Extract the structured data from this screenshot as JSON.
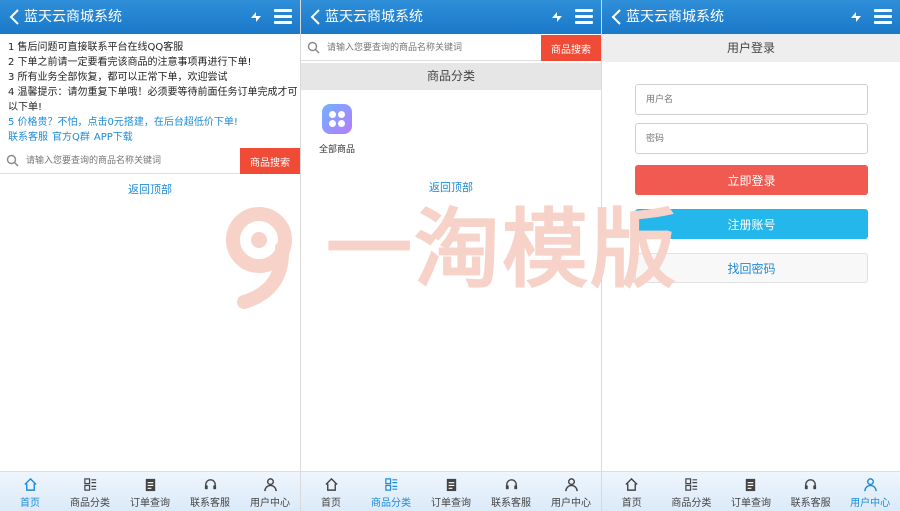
{
  "app": {
    "title": "蓝天云商城系统"
  },
  "home": {
    "notices": [
      "1 售后问题可直接联系平台在线QQ客服",
      "2 下单之前请一定要看完该商品的注意事项再进行下单!",
      "3 所有业务全部恢复，都可以正常下单，欢迎尝试",
      "4 温馨提示：请勿重复下单哦！必须要等待前面任务订单完成才可以下单!",
      "5 价格贵？不怕，点击0元搭建，在后台超低价下单!"
    ],
    "links": [
      "联系客服",
      "官方Q群",
      "APP下载"
    ]
  },
  "search": {
    "placeholder": "请输入您要查询的商品名称关键词",
    "button": "商品搜索"
  },
  "back_to_top": "返回顶部",
  "category": {
    "header": "商品分类",
    "items": [
      {
        "label": "全部商品"
      }
    ]
  },
  "login": {
    "header": "用户登录",
    "username_placeholder": "用户名",
    "password_placeholder": "密码",
    "login_button": "立即登录",
    "register_button": "注册账号",
    "forgot_button": "找回密码"
  },
  "tabs": [
    "首页",
    "商品分类",
    "订单查询",
    "联系客服",
    "用户中心"
  ],
  "watermark": "一淘模版",
  "colors": {
    "topbar": "#1a78c9",
    "search_button": "#ef4b36",
    "login_button": "#f05a50",
    "register_button": "#24b7ec",
    "accent": "#1e8bd6"
  }
}
